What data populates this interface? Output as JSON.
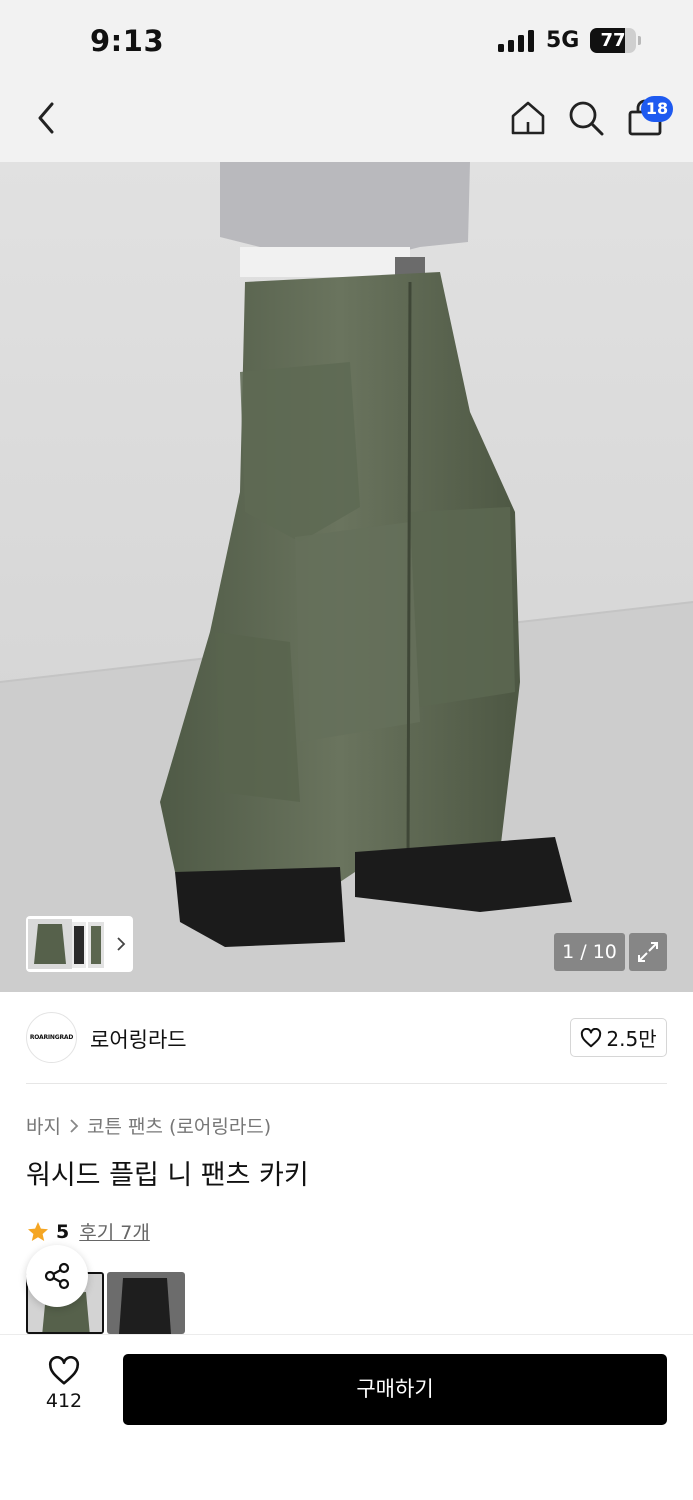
{
  "status_bar": {
    "time": "9:13",
    "network": "5G",
    "battery_percent": "77"
  },
  "nav": {
    "back_icon": "chevron-left-icon",
    "home_icon": "home-icon",
    "search_icon": "search-icon",
    "cart_icon": "shopping-bag-icon",
    "cart_count": "18",
    "badge_color": "#1e5af0"
  },
  "gallery": {
    "counter": "1 / 10",
    "current": 1,
    "total": 10,
    "expand_icon": "expand-icon"
  },
  "brand": {
    "logo_text": "ROARINGRAD",
    "name": "로어링라드",
    "likes": "2.5만"
  },
  "product": {
    "category_parent": "바지",
    "category_child": "코튼 팬츠 (로어링라드)",
    "title": "워시드 플립 니 팬츠 카키",
    "rating": "5",
    "review_link": "후기 7개",
    "star_color": "#f5a623"
  },
  "bottom_bar": {
    "wish_count": "412",
    "buy_label": "구매하기"
  }
}
